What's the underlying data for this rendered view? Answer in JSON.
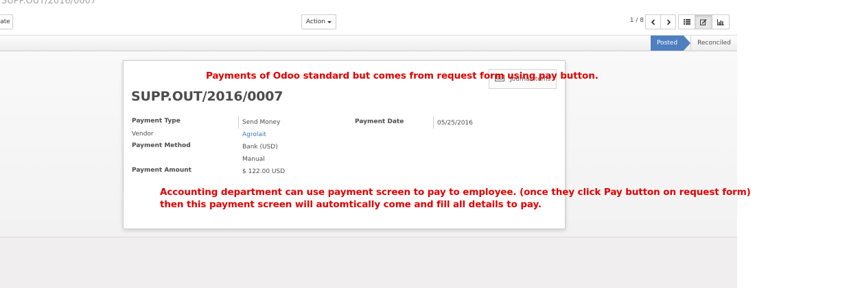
{
  "breadcrumb": "SUPP.OUT/2016/0007",
  "toolbar": {
    "create_label": "ate",
    "action_label": "Action"
  },
  "pager": {
    "value": "1 / 8"
  },
  "status_stages": {
    "posted": "Posted",
    "reconciled": "Reconciled",
    "active": "Posted",
    "active_color": "#4e7fbf"
  },
  "sheet": {
    "title": "SUPP.OUT/2016/0007",
    "journal_items_label": "Journal Items",
    "fields": {
      "payment_type_label": "Payment Type",
      "payment_type_value": "Send Money",
      "vendor_label": "Vendor",
      "vendor_value": "Agrolait",
      "payment_method_label": "Payment Method",
      "payment_method_value": "Bank (USD)",
      "payment_method_sub": "Manual",
      "payment_amount_label": "Payment Amount",
      "payment_amount_value": "$ 122.00 USD",
      "payment_date_label": "Payment Date",
      "payment_date_value": "05/25/2016"
    }
  },
  "annotations": {
    "top": "Payments of Odoo standard but comes from request form using pay button.",
    "bottom_line1": "Accounting department can use payment screen to pay to employee. (once they click Pay button on request form)",
    "bottom_line2": "then this payment screen will automtically come and fill all details to pay.",
    "color": "#e00000"
  },
  "icons": {
    "prev": "chevron-left-icon",
    "next": "chevron-right-icon",
    "list": "list-view-icon",
    "form": "form-view-icon",
    "graph": "graph-view-icon",
    "journal": "journal-items-icon"
  }
}
